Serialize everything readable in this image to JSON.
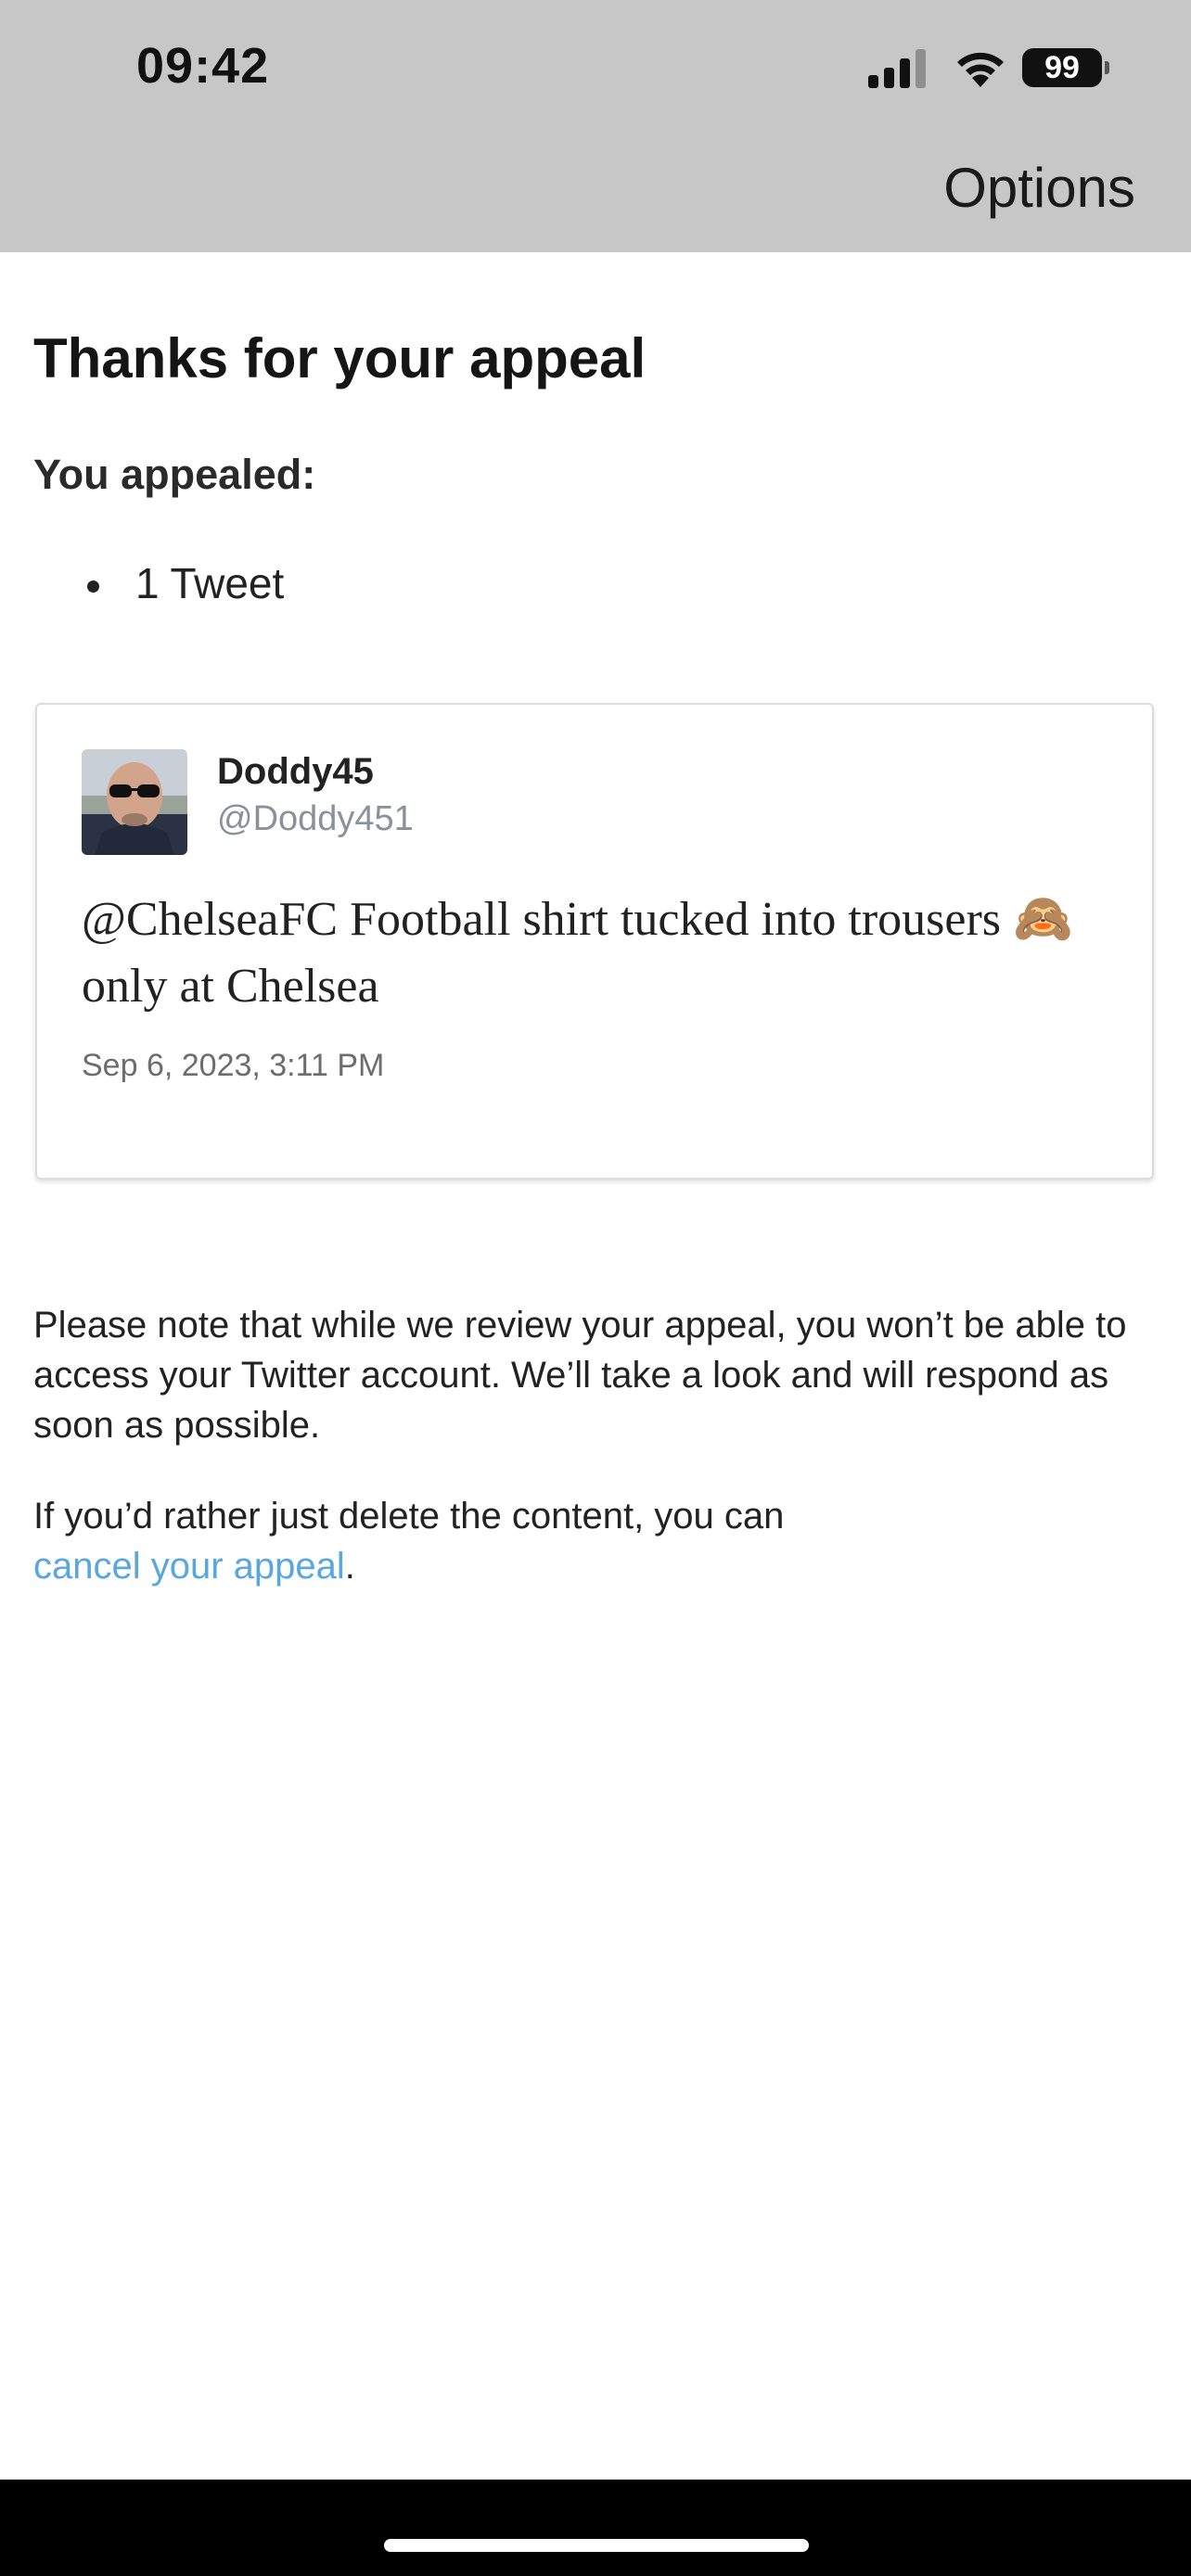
{
  "status_bar": {
    "time": "09:42",
    "battery": "99",
    "signal_icon": "signal-bars-icon",
    "wifi_icon": "wifi-icon"
  },
  "header": {
    "options_label": "Options",
    "background": "#c7c7c7"
  },
  "main": {
    "title": "Thanks for your appeal",
    "appealed_label": "You appealed:",
    "appealed_items": [
      "1 Tweet"
    ]
  },
  "tweet": {
    "display_name": "Doddy45",
    "handle": "@Doddy451",
    "text": "@ChelseaFC Football shirt tucked into trousers 🙈 only at Chelsea",
    "timestamp": "Sep 6, 2023, 3:11 PM"
  },
  "notes": {
    "review_notice": "Please note that while we review your appeal, you won’t be able to access your Twitter account. We’ll take a look and will respond as soon as possible.",
    "cancel_prefix": "If you’d rather just delete the content, you can",
    "cancel_link": "cancel your appeal",
    "cancel_suffix": ".",
    "link_color": "#5aa6de"
  }
}
